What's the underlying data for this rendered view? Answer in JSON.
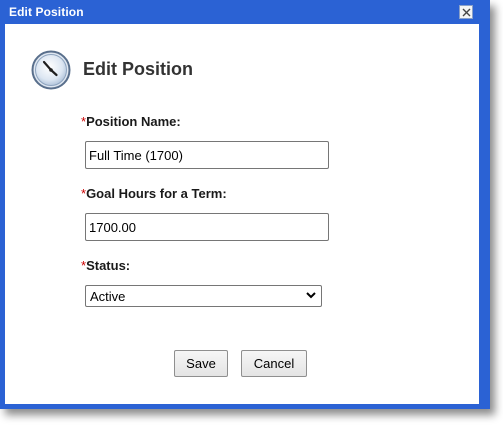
{
  "window": {
    "title": "Edit Position"
  },
  "header": {
    "title": "Edit Position",
    "icon": "clock-icon"
  },
  "form": {
    "required_marker": "*",
    "position_name": {
      "label": "Position Name:",
      "value": "Full Time (1700)"
    },
    "goal_hours": {
      "label": "Goal Hours for a Term:",
      "value": "1700.00"
    },
    "status": {
      "label": "Status:",
      "value": "Active"
    }
  },
  "buttons": {
    "save": "Save",
    "cancel": "Cancel"
  },
  "colors": {
    "titlebar": "#2b62d4",
    "required": "#cc0000"
  }
}
